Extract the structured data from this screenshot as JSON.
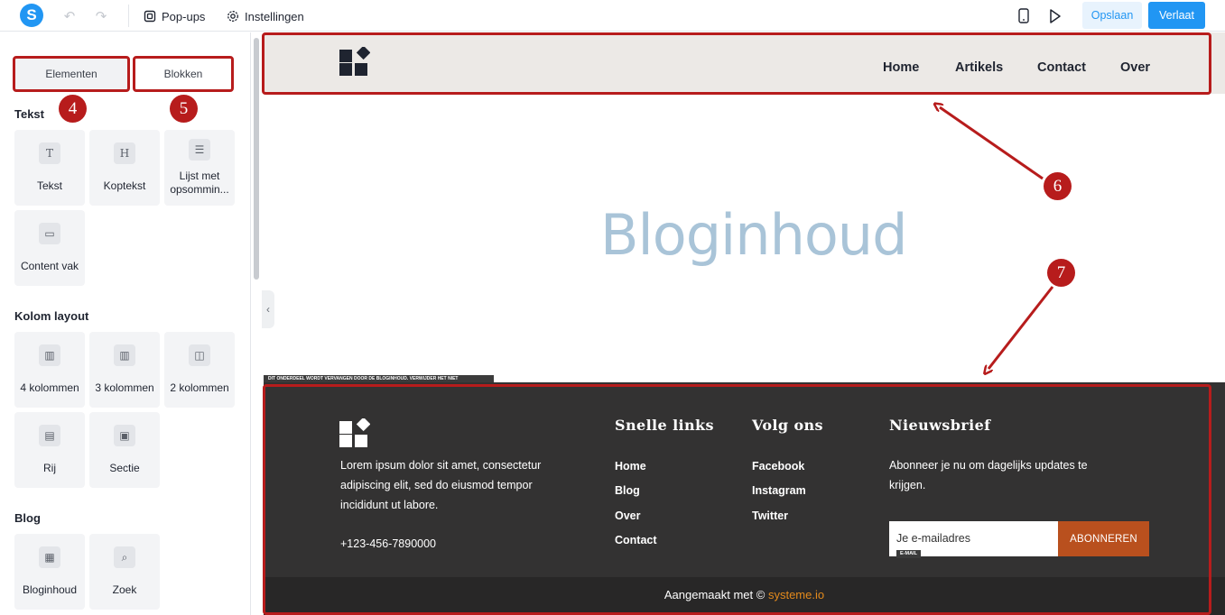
{
  "topbar": {
    "logo_letter": "S",
    "undo_icon": "undo-icon",
    "redo_icon": "redo-icon",
    "popups_label": "Pop-ups",
    "settings_label": "Instellingen",
    "save_label": "Opslaan",
    "exit_label": "Verlaat",
    "accent_color": "#2196f3"
  },
  "sidebar": {
    "tabs": [
      {
        "label": "Elementen",
        "active": true
      },
      {
        "label": "Blokken",
        "active": false
      }
    ],
    "sections": [
      {
        "title": "Tekst",
        "items": [
          {
            "label": "Tekst",
            "icon": "text-icon"
          },
          {
            "label": "Koptekst",
            "icon": "heading-icon"
          },
          {
            "label": "Lijst met opsommin...",
            "icon": "list-icon"
          },
          {
            "label": "Content vak",
            "icon": "content-box-icon"
          }
        ]
      },
      {
        "title": "Kolom layout",
        "items": [
          {
            "label": "4 kolommen",
            "icon": "four-columns-icon"
          },
          {
            "label": "3 kolommen",
            "icon": "three-columns-icon"
          },
          {
            "label": "2 kolommen",
            "icon": "two-columns-icon"
          },
          {
            "label": "Rij",
            "icon": "row-icon"
          },
          {
            "label": "Sectie",
            "icon": "section-icon"
          }
        ]
      },
      {
        "title": "Blog",
        "items": [
          {
            "label": "Bloginhoud",
            "icon": "blog-content-icon"
          },
          {
            "label": "Zoek",
            "icon": "search-icon"
          }
        ]
      }
    ]
  },
  "annotations": {
    "badges": [
      "4",
      "5",
      "6",
      "7"
    ],
    "color": "#b71c1c"
  },
  "site": {
    "nav": [
      "Home",
      "Artikels",
      "Contact",
      "Over"
    ],
    "blog_placeholder": "Bloginhoud",
    "footer_note": "DIT ONDERDEEL WORDT VERVANGEN DOOR DE BLOGINHOUD. VERWIJDER HET NIET",
    "footer": {
      "about_lines": [
        "Lorem ipsum dolor sit amet, consectetur",
        "adipiscing elit, sed do eiusmod tempor",
        "incididunt ut labore."
      ],
      "phone": "+123-456-7890000",
      "quick_links_title": "Snelle links",
      "quick_links": [
        "Home",
        "Blog",
        "Over",
        "Contact"
      ],
      "follow_title": "Volg ons",
      "follow_links": [
        "Facebook",
        "Instagram",
        "Twitter"
      ],
      "newsletter_title": "Nieuwsbrief",
      "newsletter_lines": [
        "Abonneer je nu om dagelijks updates te",
        "krijgen."
      ],
      "email_placeholder": "Je e-mailadres",
      "email_tag": "E-MAIL",
      "subscribe_label": "ABONNEREN",
      "copyright_prefix": "Aangemaakt met ©",
      "copyright_brand": "systeme.io"
    }
  }
}
